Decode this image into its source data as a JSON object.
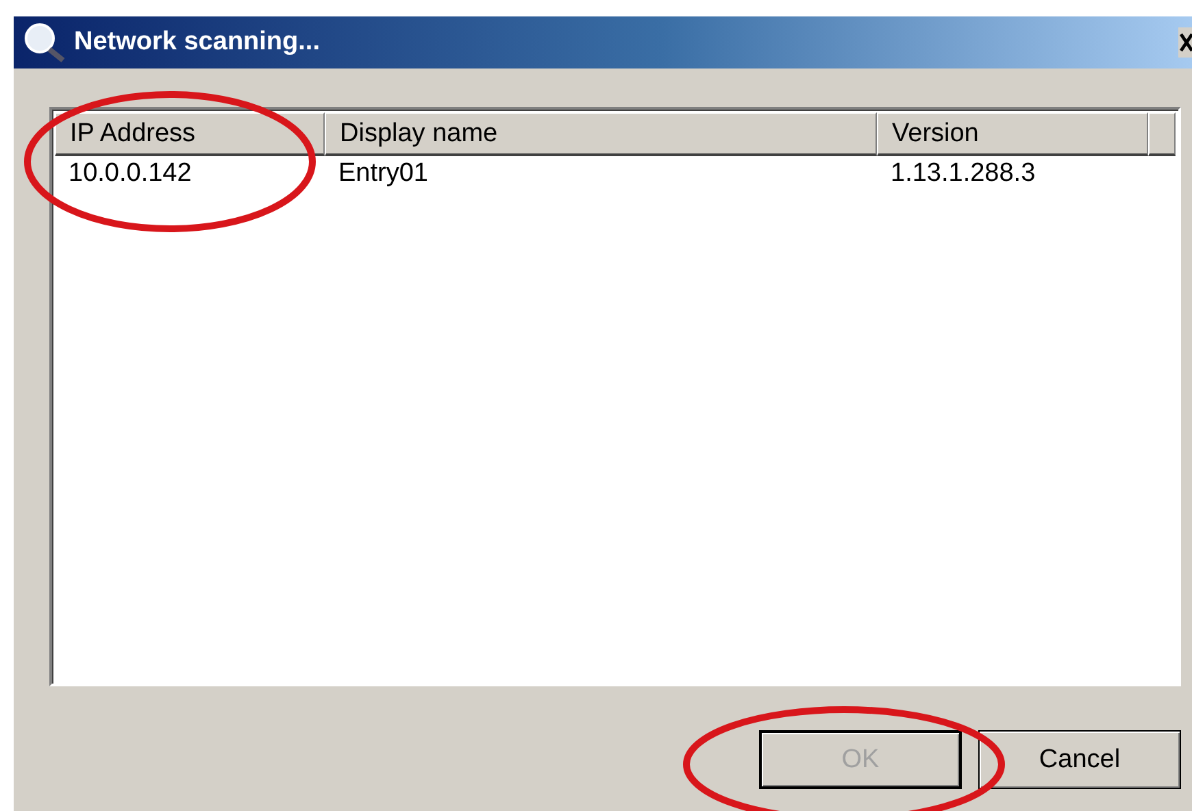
{
  "window": {
    "title": "Network scanning..."
  },
  "table": {
    "columns": [
      "IP Address",
      "Display name",
      "Version"
    ],
    "rows": [
      {
        "cells": [
          "10.0.0.142",
          "Entry01",
          "1.13.1.288.3"
        ],
        "selected": false
      }
    ]
  },
  "buttons": [
    {
      "label": "OK",
      "disabled": true
    },
    {
      "label": "Cancel",
      "disabled": false
    }
  ]
}
